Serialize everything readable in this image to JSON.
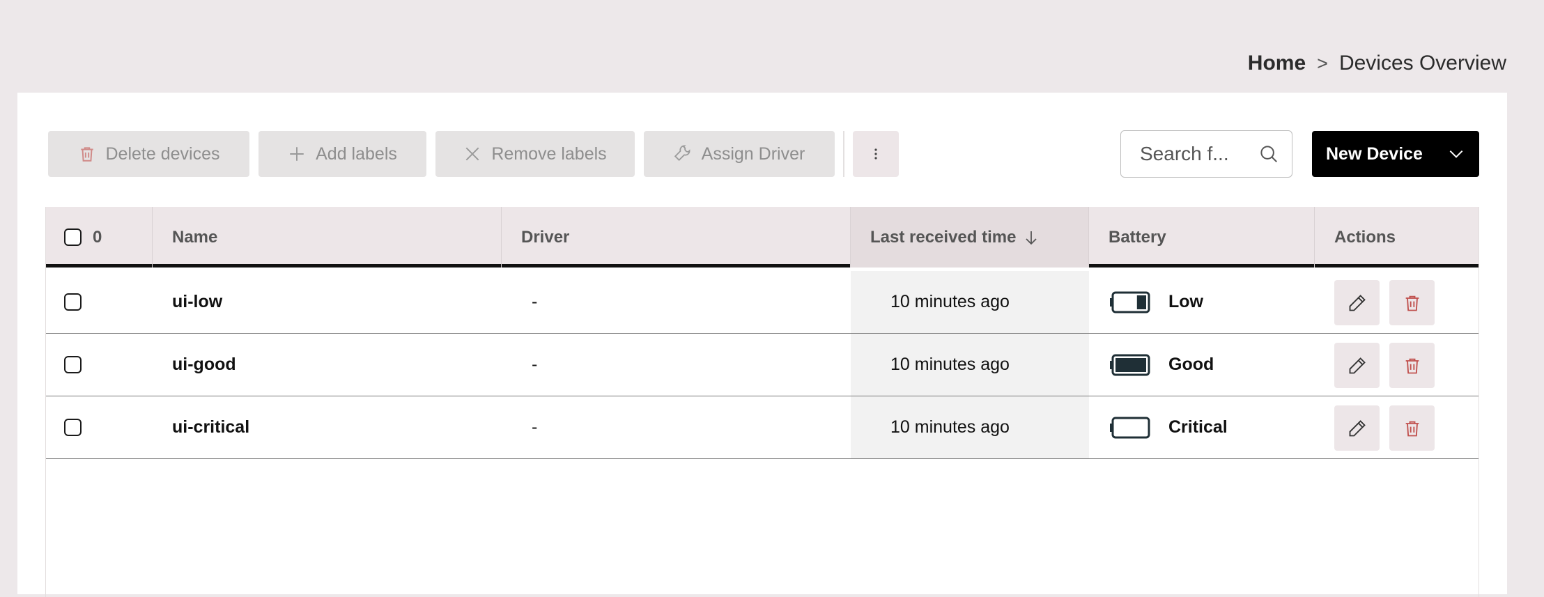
{
  "breadcrumb": {
    "home": "Home",
    "separator": ">",
    "current": "Devices Overview"
  },
  "toolbar": {
    "delete_label": "Delete devices",
    "add_labels_label": "Add labels",
    "remove_labels_label": "Remove labels",
    "assign_driver_label": "Assign Driver",
    "more_icon": "more-vertical-icon",
    "search_placeholder": "Search f...",
    "new_device_label": "New Device"
  },
  "table": {
    "selected_count": "0",
    "columns": {
      "name": "Name",
      "driver": "Driver",
      "last_received": "Last received time",
      "battery": "Battery",
      "actions": "Actions"
    },
    "sort": {
      "column": "last_received",
      "direction": "descending"
    },
    "rows": [
      {
        "name": "ui-low",
        "driver": "-",
        "last_received": "10 minutes ago",
        "battery": "Low",
        "battery_level": 0.3
      },
      {
        "name": "ui-good",
        "driver": "-",
        "last_received": "10 minutes ago",
        "battery": "Good",
        "battery_level": 1.0
      },
      {
        "name": "ui-critical",
        "driver": "-",
        "last_received": "10 minutes ago",
        "battery": "Critical",
        "battery_level": 0.0
      }
    ]
  },
  "colors": {
    "delete_red": "#c0504d",
    "battery_fill": "#1f2f36",
    "primary": "#000000"
  }
}
